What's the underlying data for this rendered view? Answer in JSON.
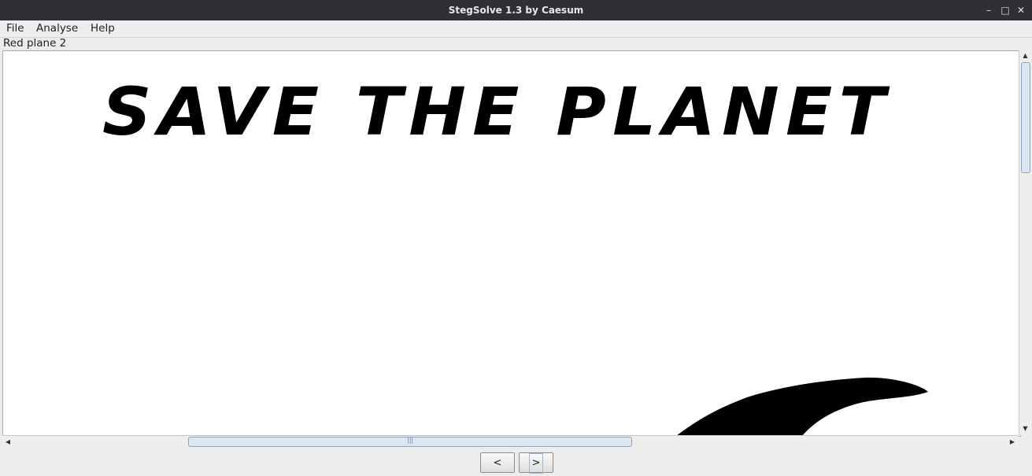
{
  "window": {
    "title": "StegSolve 1.3 by Caesum"
  },
  "window_buttons": {
    "minimize": "–",
    "maximize": "□",
    "close": "✕"
  },
  "menu": {
    "items": [
      "File",
      "Analyse",
      "Help"
    ]
  },
  "plane_label": "Red plane 2",
  "image_content": {
    "text": "SAVE THE PLANET"
  },
  "nav": {
    "prev": "<",
    "next": ">"
  },
  "icons": {
    "scroll_up": "scroll-up-icon",
    "scroll_down": "scroll-down-icon",
    "scroll_left": "scroll-left-icon",
    "scroll_right": "scroll-right-icon"
  }
}
